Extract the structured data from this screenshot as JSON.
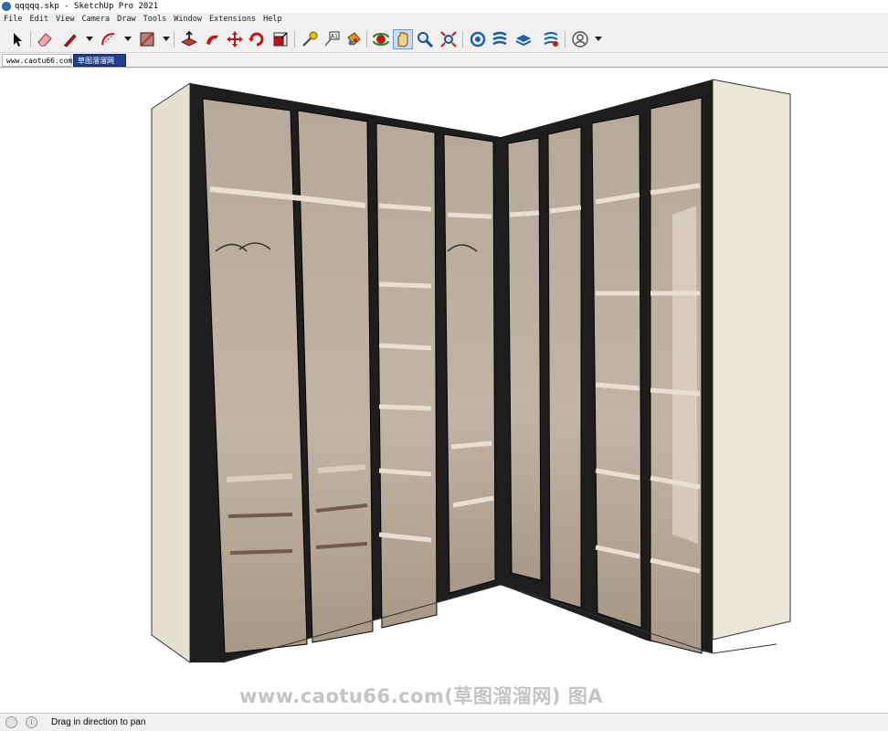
{
  "window": {
    "title": "qqqqq.skp - SketchUp Pro 2021"
  },
  "menu": [
    "File",
    "Edit",
    "View",
    "Camera",
    "Draw",
    "Tools",
    "Window",
    "Extensions",
    "Help"
  ],
  "toolbar": {
    "tools": [
      {
        "name": "select-tool-icon"
      },
      {
        "name": "eraser-tool-icon"
      },
      {
        "name": "pencil-line-tool-icon"
      },
      {
        "name": "arc-tool-icon"
      },
      {
        "name": "shape-rectangle-tool-icon"
      },
      {
        "name": "push-pull-tool-icon"
      },
      {
        "name": "follow-me-tool-icon"
      },
      {
        "name": "move-tool-icon"
      },
      {
        "name": "rotate-tool-icon"
      },
      {
        "name": "scale-tool-icon"
      },
      {
        "name": "tape-measure-tool-icon"
      },
      {
        "name": "text-label-tool-icon"
      },
      {
        "name": "paint-bucket-tool-icon"
      },
      {
        "name": "orbit-tool-icon"
      },
      {
        "name": "pan-tool-icon"
      },
      {
        "name": "zoom-tool-icon"
      },
      {
        "name": "zoom-extents-tool-icon"
      },
      {
        "name": "warehouse-icon"
      },
      {
        "name": "extension-warehouse-icon"
      },
      {
        "name": "layout-send-icon"
      },
      {
        "name": "extension-manager-icon"
      },
      {
        "name": "account-icon"
      }
    ],
    "active_tool": "pan-tool-icon"
  },
  "tabs": [
    {
      "label": "www.caotu66.com"
    },
    {
      "label": "草图溜溜网"
    }
  ],
  "viewport": {
    "watermark": "www.caotu66.com(草图溜溜网) 图A"
  },
  "status": {
    "message": "Drag in direction to pan",
    "info_icon": "i"
  },
  "colors": {
    "frame": "#1f1f1f",
    "cabinet_side": "#e8e2d6",
    "glass": "#b8aa9a",
    "interior": "#cfc3b3",
    "active_tab": "#1e3f8f"
  }
}
